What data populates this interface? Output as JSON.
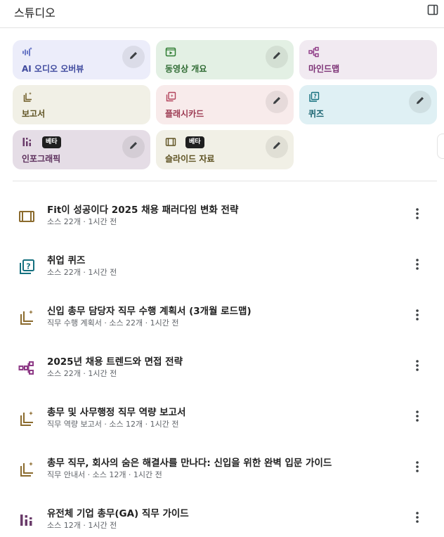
{
  "header": {
    "title": "스튜디오"
  },
  "colors": {
    "blue_card": "#ecedfa",
    "green_card": "#e3f0e4",
    "purple_card": "#f1eaf1",
    "beige_card": "#f1f0e6",
    "pink_card": "#f8ebeb",
    "cyan_card": "#dff0f4",
    "mauve_card": "#e5dde6",
    "brown_icon": "#8b6b2e",
    "purple_icon": "#8e3a86",
    "blue_icon": "#1a73e8",
    "green_icon": "#2f7d32",
    "rose_icon": "#b3445d",
    "teal_icon": "#15707f"
  },
  "cards": [
    {
      "label": "AI 오디오 오버뷰",
      "icon": "audio-wave-icon"
    },
    {
      "label": "동영상 개요",
      "icon": "video-icon"
    },
    {
      "label": "마인드맵",
      "icon": "mind-map-icon"
    },
    {
      "label": "보고서",
      "icon": "report-icon"
    },
    {
      "label": "플래시카드",
      "icon": "flashcard-icon"
    },
    {
      "label": "퀴즈",
      "icon": "quiz-icon"
    },
    {
      "label": "인포그래픽",
      "icon": "infographic-icon",
      "badge": "베타"
    },
    {
      "label": "슬라이드 자료",
      "icon": "slides-icon",
      "badge": "베타"
    }
  ],
  "items": [
    {
      "title": "Fit이 성공이다 2025 채용 패러다임 변화 전략",
      "meta": "소스 22개 · 1시간 전",
      "icon": "slides-icon"
    },
    {
      "title": "취업 퀴즈",
      "meta": "소스 22개 · 1시간 전",
      "icon": "quiz-icon"
    },
    {
      "title": "신입 총무 담당자 직무 수행 계획서 (3개월 로드맵)",
      "meta": "직무 수행 계획서 · 소스 22개 · 1시간 전",
      "icon": "report-icon"
    },
    {
      "title": "2025년 채용 트렌드와 면접 전략",
      "meta": "소스 22개 · 1시간 전",
      "icon": "mind-map-icon"
    },
    {
      "title": "총무 및 사무행정 직무 역량 보고서",
      "meta": "직무 역량 보고서 · 소스 12개 · 1시간 전",
      "icon": "report-icon"
    },
    {
      "title": "총무 직무, 회사의 숨은 해결사를 만나다: 신입을 위한 완벽 입문 가이드",
      "meta": "직무 안내서 · 소스 12개 · 1시간 전",
      "icon": "report-icon"
    },
    {
      "title": "유전체 기업 총무(GA) 직무 가이드",
      "meta": "소스 12개 · 1시간 전",
      "icon": "infographic-icon"
    }
  ]
}
